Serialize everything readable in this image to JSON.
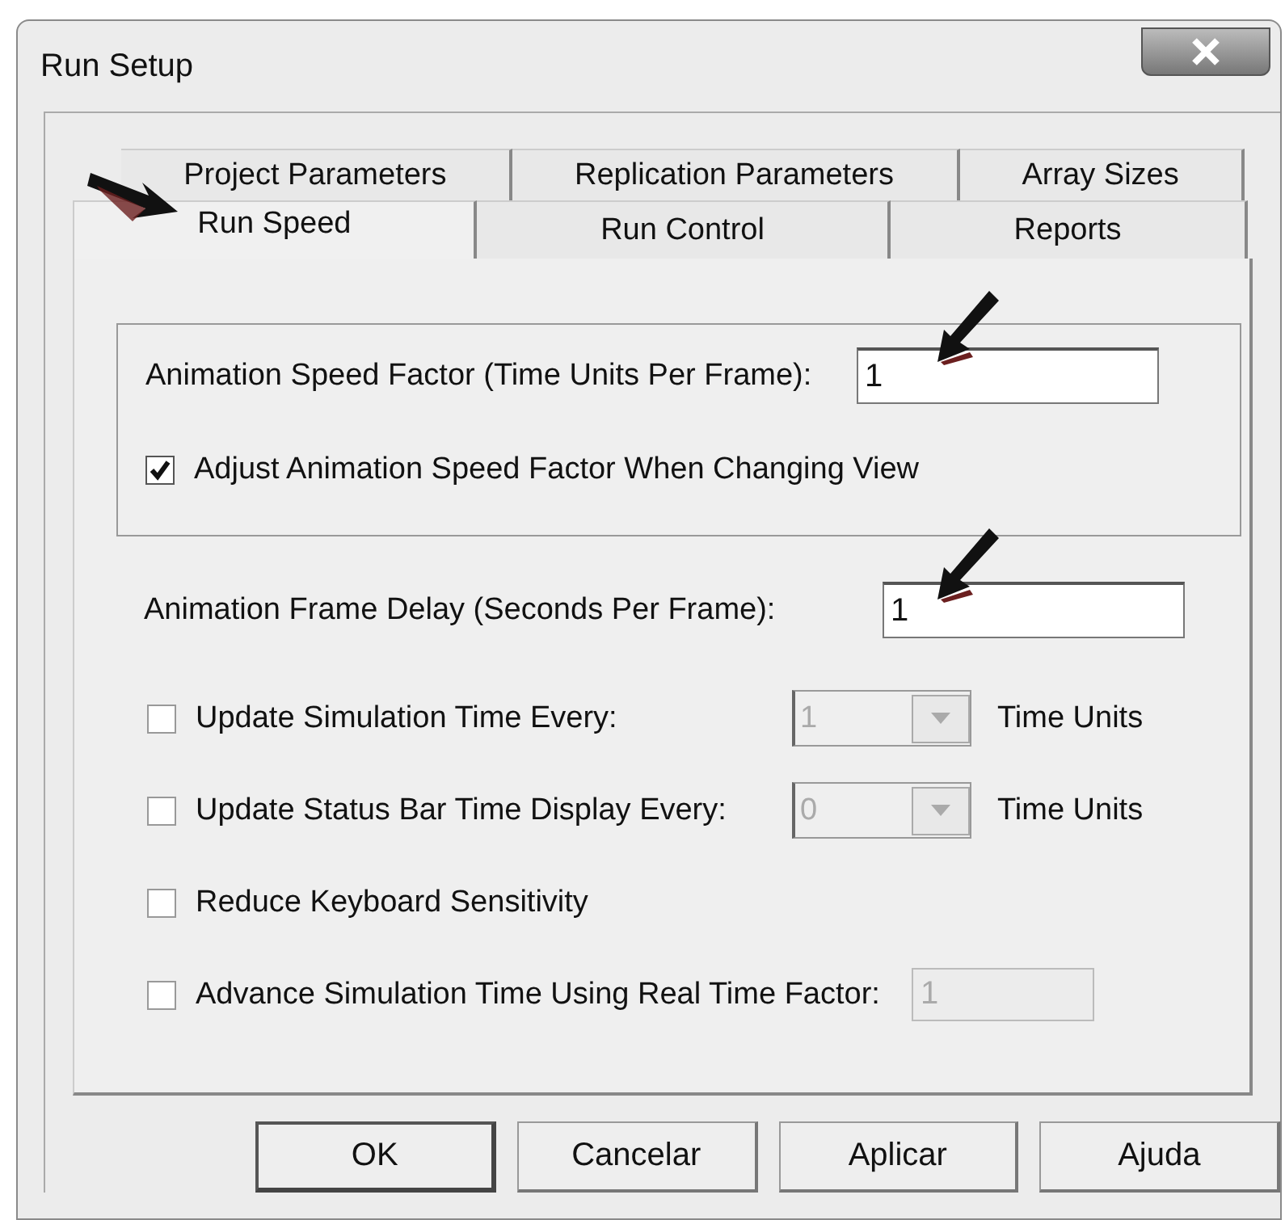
{
  "window": {
    "title": "Run Setup"
  },
  "tab_rows": [
    {
      "tabs": [
        {
          "label": "Project Parameters",
          "selected": false
        },
        {
          "label": "Replication Parameters",
          "selected": false
        },
        {
          "label": "Array Sizes",
          "selected": false
        }
      ]
    },
    {
      "tabs": [
        {
          "label": "Run Speed",
          "selected": true
        },
        {
          "label": "Run Control",
          "selected": false
        },
        {
          "label": "Reports",
          "selected": false
        }
      ]
    }
  ],
  "speed_group": {
    "label": "Animation Speed Factor (Time Units Per Frame):",
    "value": "1",
    "checkbox": {
      "label": "Adjust Animation Speed Factor When Changing View",
      "checked": true
    }
  },
  "frame_delay": {
    "label": "Animation Frame Delay (Seconds Per Frame):",
    "value": "1"
  },
  "options": [
    {
      "kind": "combo",
      "label": "Update Simulation Time Every:",
      "checked": false,
      "value": "1",
      "disabled": true,
      "unit": "Time Units"
    },
    {
      "kind": "combo",
      "label": "Update Status Bar Time Display Every:",
      "checked": false,
      "value": "0",
      "disabled": true,
      "unit": "Time Units"
    },
    {
      "kind": "plain",
      "label": "Reduce Keyboard Sensitivity",
      "checked": false
    },
    {
      "kind": "field",
      "label": "Advance Simulation Time Using Real Time Factor:",
      "checked": false,
      "value": "1",
      "disabled": true
    }
  ],
  "buttons": [
    {
      "label": "OK",
      "default": true
    },
    {
      "label": "Cancelar",
      "default": false
    },
    {
      "label": "Aplicar",
      "default": false
    },
    {
      "label": "Ajuda",
      "default": false
    }
  ]
}
